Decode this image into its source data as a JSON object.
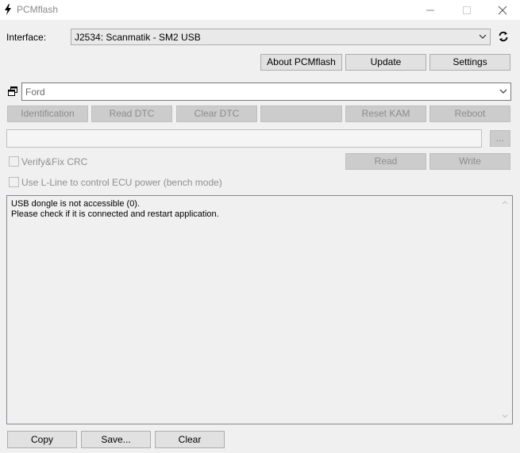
{
  "window": {
    "title": "PCMflash",
    "icons": {
      "app": "lightning-bolt-icon",
      "minimize": "minimize-icon",
      "maximize": "maximize-icon",
      "close": "close-icon"
    }
  },
  "interface": {
    "label": "Interface:",
    "selected": "J2534: Scanmatik - SM2 USB",
    "refresh_icon": "refresh-icon"
  },
  "top_buttons": {
    "about": "About PCMflash",
    "update": "Update",
    "settings": "Settings"
  },
  "vehicle": {
    "selected": "Ford",
    "detach_icon": "window-restore-icon"
  },
  "action_buttons": {
    "identification": "Identification",
    "read_dtc": "Read DTC",
    "clear_dtc": "Clear DTC",
    "blank": "",
    "reset_kam": "Reset KAM",
    "reboot": "Reboot"
  },
  "file": {
    "path": "",
    "browse_label": "..."
  },
  "options": {
    "verify_fix_crc": "Verify&Fix CRC",
    "lline_power": "Use L-Line to control ECU power (bench mode)",
    "verify_checked": false,
    "lline_checked": false
  },
  "rw_buttons": {
    "read": "Read",
    "write": "Write"
  },
  "log": {
    "lines": [
      "USB dongle is not accessible (0).",
      "Please check if it is connected and restart application."
    ]
  },
  "bottom_buttons": {
    "copy": "Copy",
    "save": "Save...",
    "clear": "Clear"
  }
}
